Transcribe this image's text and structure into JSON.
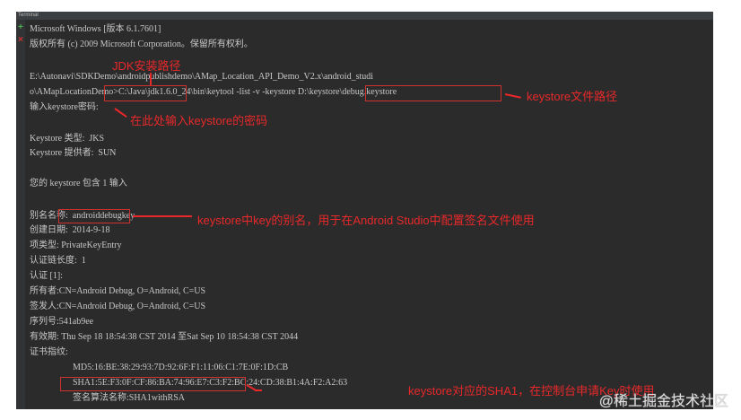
{
  "window": {
    "title": "Terminal"
  },
  "gutter": {
    "add_icon": "+",
    "close_icon": "×"
  },
  "lines": [
    "Microsoft Windows [版本 6.1.7601]",
    "版权所有 (c) 2009 Microsoft Corporation。保留所有权利。",
    "E:\\Autonavi\\SDKDemo\\androidpublishdemo\\AMap_Location_API_Demo_V2.x\\android_studi",
    "o\\AMapLocationDemo>C:\\Java\\jdk1.6.0_24\\bin\\keytool -list -v -keystore D:\\keystore\\debug.keystore",
    "输入keystore密码:",
    "Keystore 类型:  JKS",
    "Keystore 提供者:  SUN",
    "您的 keystore 包含 1 输入",
    "别名名称:  androiddebugkey",
    "创建日期:  2014-9-18",
    "项类型: PrivateKeyEntry",
    "认证链长度:  1",
    "认证 [1]:",
    "所有者:CN=Android Debug, O=Android, C=US",
    "签发人:CN=Android Debug, O=Android, C=US",
    "序列号:541ab9ee",
    "有效期: Thu Sep 18 18:54:38 CST 2014 至Sat Sep 10 18:54:38 CST 2044",
    "证书指纹:",
    "MD5:16:BE:38:29:93:7D:92:6F:F1:11:06:C1:7E:0F:1D:CB",
    "SHA1:5E:F3:0F:CF:86:BA:74:96:E7:C3:F2:BC:24:CD:38:B1:4A:F2:A2:63",
    "签名算法名称:SHA1withRSA"
  ],
  "annotations": {
    "jdk": "JDK安装路径",
    "keystore_path": "keystore文件路径",
    "password": "在此处输入keystore的密码",
    "alias": "keystore中key的别名，用于在Android Studio中配置签名文件使用",
    "sha1": "keystore对应的SHA1，在控制台申请Key时使用"
  },
  "watermark": "@稀土掘金技术社区",
  "colors": {
    "annotation": "#e8282a",
    "terminal_bg": "#2b2b2b"
  }
}
